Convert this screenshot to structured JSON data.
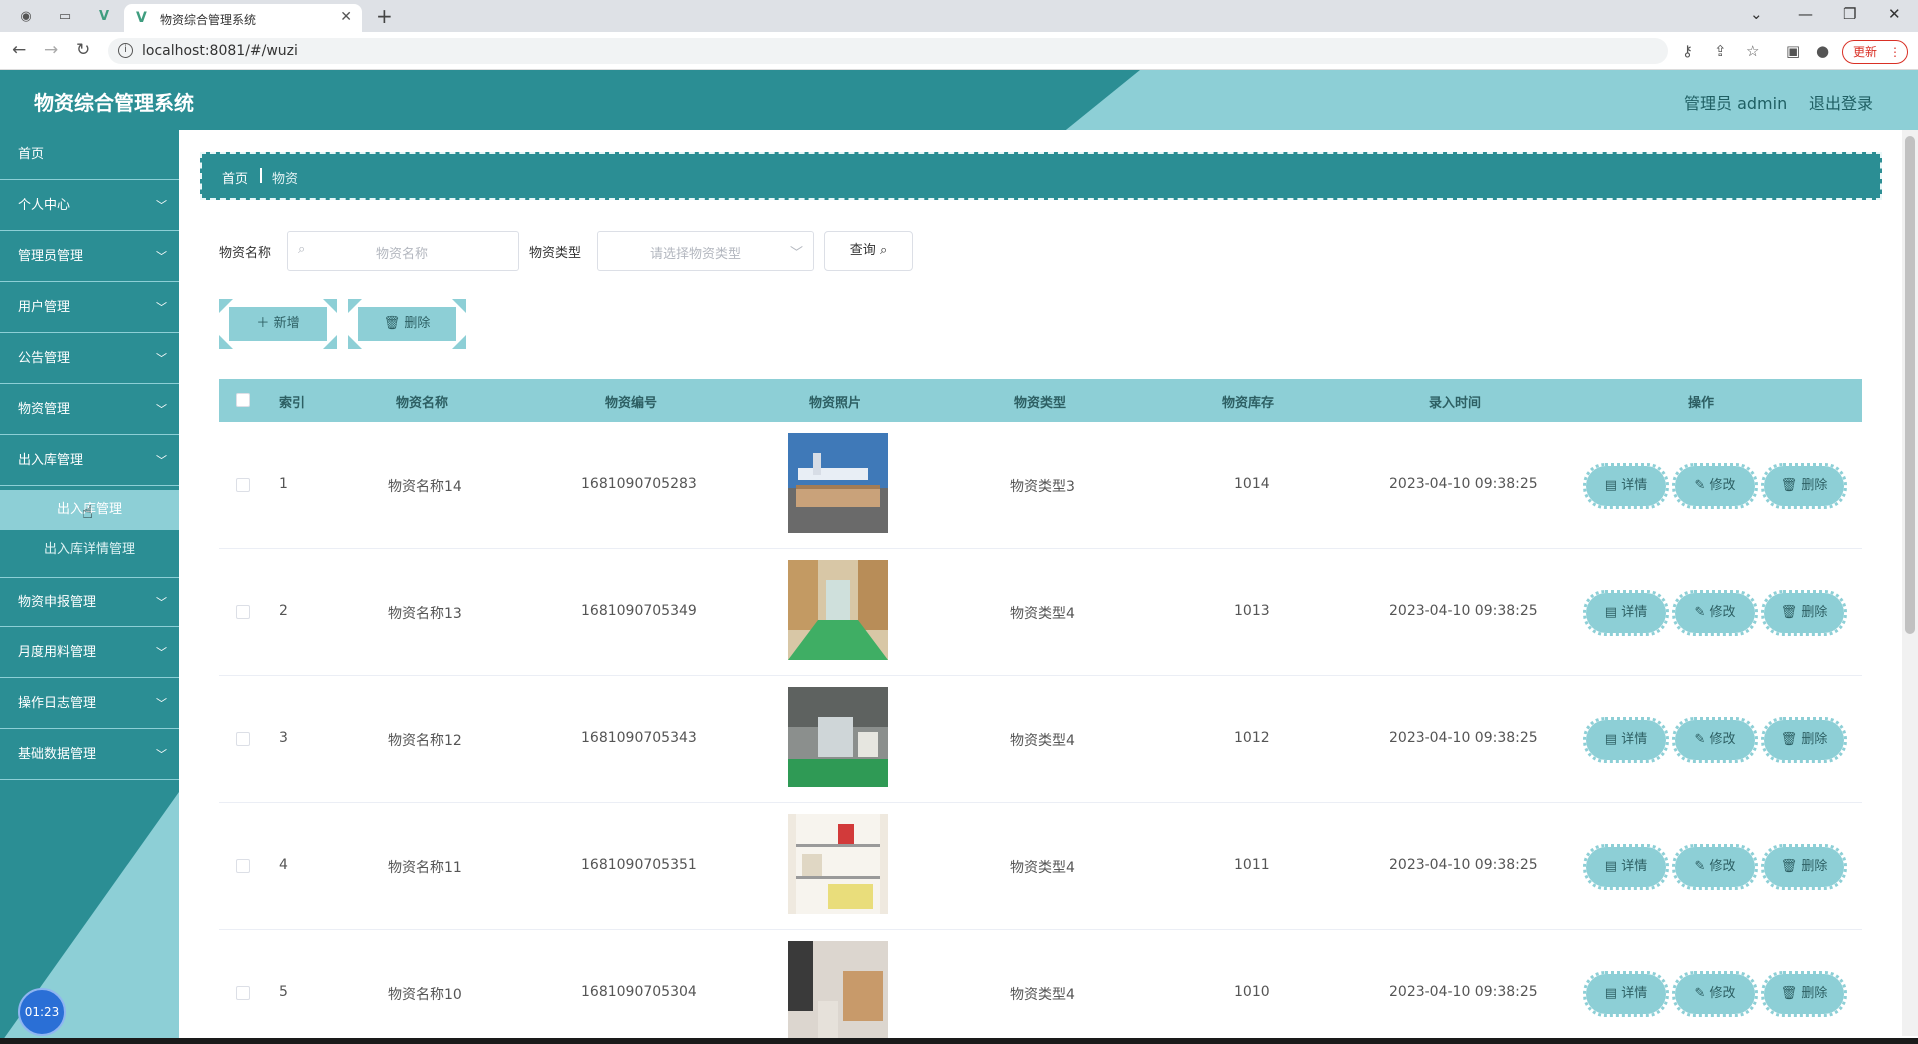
{
  "browser": {
    "tab_title": "物资综合管理系统",
    "url": "localhost:8081/#/wuzi",
    "update_label": "更新"
  },
  "header": {
    "title": "物资综合管理系统",
    "user": "管理员 admin",
    "logout": "退出登录"
  },
  "sidebar": {
    "items": [
      {
        "label": "首页",
        "has_arrow": false
      },
      {
        "label": "个人中心",
        "has_arrow": true
      },
      {
        "label": "管理员管理",
        "has_arrow": true
      },
      {
        "label": "用户管理",
        "has_arrow": true
      },
      {
        "label": "公告管理",
        "has_arrow": true
      },
      {
        "label": "物资管理",
        "has_arrow": true
      },
      {
        "label": "出入库管理",
        "has_arrow": true
      },
      {
        "label": "物资申报管理",
        "has_arrow": true
      },
      {
        "label": "月度用料管理",
        "has_arrow": true
      },
      {
        "label": "操作日志管理",
        "has_arrow": true
      },
      {
        "label": "基础数据管理",
        "has_arrow": true
      }
    ],
    "submenu": [
      {
        "label": "出入库管理",
        "active": true
      },
      {
        "label": "出入库详情管理",
        "active": false
      }
    ],
    "timer": "01:23"
  },
  "breadcrumb": {
    "home": "首页",
    "current": "物资"
  },
  "search": {
    "name_label": "物资名称",
    "name_placeholder": "物资名称",
    "type_label": "物资类型",
    "type_placeholder": "请选择物资类型",
    "query_label": "查询"
  },
  "actions": {
    "add": "新增",
    "delete": "删除"
  },
  "table": {
    "headers": [
      "索引",
      "物资名称",
      "物资编号",
      "物资照片",
      "物资类型",
      "物资库存",
      "录入时间",
      "操作"
    ],
    "rows": [
      {
        "index": "1",
        "name": "物资名称14",
        "code": "1681090705283",
        "type": "物资类型3",
        "stock": "1014",
        "time": "2023-04-10 09:38:25"
      },
      {
        "index": "2",
        "name": "物资名称13",
        "code": "1681090705349",
        "type": "物资类型4",
        "stock": "1013",
        "time": "2023-04-10 09:38:25"
      },
      {
        "index": "3",
        "name": "物资名称12",
        "code": "1681090705343",
        "type": "物资类型4",
        "stock": "1012",
        "time": "2023-04-10 09:38:25"
      },
      {
        "index": "4",
        "name": "物资名称11",
        "code": "1681090705351",
        "type": "物资类型4",
        "stock": "1011",
        "time": "2023-04-10 09:38:25"
      },
      {
        "index": "5",
        "name": "物资名称10",
        "code": "1681090705304",
        "type": "物资类型4",
        "stock": "1010",
        "time": "2023-04-10 09:38:25"
      }
    ],
    "row_actions": {
      "detail": "详情",
      "edit": "修改",
      "delete": "删除"
    }
  },
  "colors": {
    "primary": "#2b8e94",
    "accent": "#8dcfd6"
  }
}
